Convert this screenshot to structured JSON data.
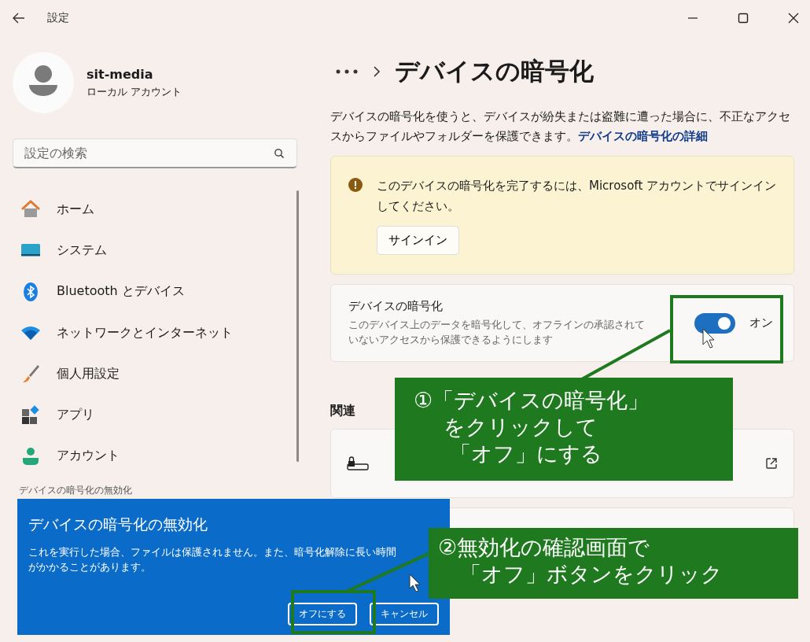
{
  "window": {
    "title": "設定"
  },
  "account": {
    "name": "sit-media",
    "type": "ローカル アカウント"
  },
  "search": {
    "placeholder": "設定の検索"
  },
  "nav": [
    {
      "kind": "home",
      "label": "ホーム"
    },
    {
      "kind": "system",
      "label": "システム"
    },
    {
      "kind": "bluetooth",
      "label": "Bluetooth とデバイス"
    },
    {
      "kind": "network",
      "label": "ネットワークとインターネット"
    },
    {
      "kind": "personalize",
      "label": "個人用設定"
    },
    {
      "kind": "apps",
      "label": "アプリ"
    },
    {
      "kind": "account",
      "label": "アカウント"
    }
  ],
  "page_title": "デバイスの暗号化",
  "description": {
    "text": "デバイスの暗号化を使うと、デバイスが紛失または盗難に遭った場合に、不正なアクセスからファイルやフォルダーを保護できます。",
    "link": "デバイスの暗号化の詳細"
  },
  "warning": {
    "message": "このデバイスの暗号化を完了するには、Microsoft アカウントでサインインしてください。",
    "button": "サインイン"
  },
  "setting": {
    "title": "デバイスの暗号化",
    "description": "このデバイス上のデータを暗号化して、オフラインの承認されていないアクセスから保護できるようにします",
    "on": true,
    "state_label": "オン"
  },
  "related": {
    "heading": "関連"
  },
  "dialog": {
    "caption": "デバイスの暗号化の無効化",
    "title": "デバイスの暗号化の無効化",
    "message": "これを実行した場合、ファイルは保護されません。また、暗号化解除に長い時間がかかることがあります。",
    "buttons": [
      "オフにする",
      "キャンセル"
    ]
  },
  "annotations": [
    {
      "lines": [
        "①「デバイスの暗号化」",
        "をクリックして",
        "「オフ」にする"
      ]
    },
    {
      "lines": [
        "②無効化の確認画面で",
        "「オフ」ボタンをクリック"
      ]
    }
  ]
}
